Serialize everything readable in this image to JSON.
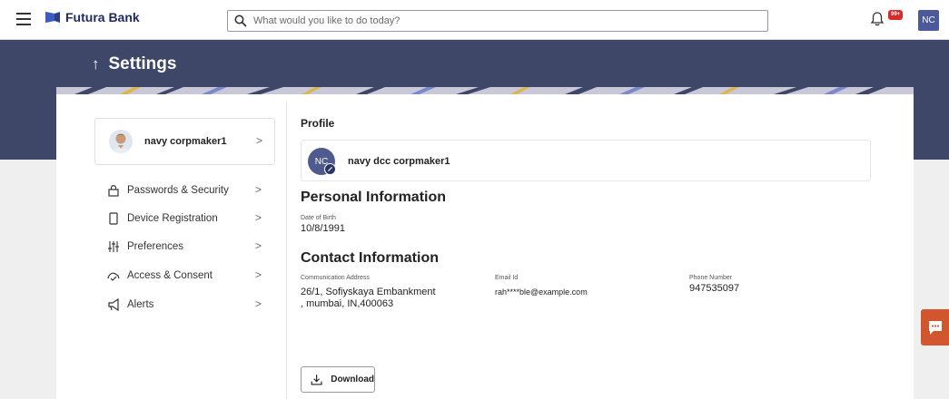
{
  "header": {
    "brand_name": "Futura Bank",
    "search_placeholder": "What would you like to do today?",
    "notification_count": "99+",
    "user_initials": "NC"
  },
  "page": {
    "title": "Settings"
  },
  "sidebar": {
    "profile_name": "navy corpmaker1",
    "items": [
      {
        "label": "Passwords & Security",
        "icon": "lock-icon"
      },
      {
        "label": "Device Registration",
        "icon": "device-icon"
      },
      {
        "label": "Preferences",
        "icon": "sliders-icon"
      },
      {
        "label": "Access & Consent",
        "icon": "consent-icon"
      },
      {
        "label": "Alerts",
        "icon": "megaphone-icon"
      }
    ]
  },
  "profile": {
    "heading": "Profile",
    "initials": "NC",
    "full_name": "navy dcc corpmaker1"
  },
  "personal_info": {
    "heading": "Personal Information",
    "dob_label": "Date of Birth",
    "dob_value": "10/8/1991"
  },
  "contact_info": {
    "heading": "Contact Information",
    "address_label": "Communication Address",
    "address_line1": "26/1, Sofiyskaya Embankment",
    "address_line2": ", mumbai, IN,400063",
    "email_label": "Email Id",
    "email_value": "rah****ble@example.com",
    "phone_label": "Phone Number",
    "phone_value": "947535097"
  },
  "actions": {
    "download_label": "Download"
  },
  "colors": {
    "banner": "#3e4767",
    "brand_text": "#1f2b5b",
    "avatar": "#4f5b8e",
    "badge": "#d62b2b",
    "chat": "#d1552d"
  }
}
